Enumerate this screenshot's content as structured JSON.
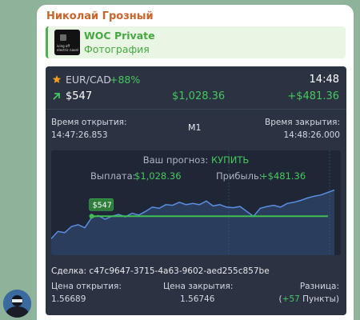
{
  "message": {
    "sender": "Николай Грозный",
    "reply": {
      "title": "WOC Private",
      "subtitle": "Фотография",
      "thumb_text": "iving off\nelectric navel"
    }
  },
  "trade": {
    "pair": "EUR/CAD",
    "pair_change": "+88%",
    "time": "14:48",
    "stake": "$547",
    "payout": "$1,028.36",
    "profit": "+$481.36",
    "open_label": "Время открытия:",
    "open_time": "14:47:26.853",
    "timeframe": "M1",
    "close_label": "Время закрытия:",
    "close_time": "14:48:26.000",
    "forecast_label": "Ваш прогноз:",
    "forecast_value": "КУПИТЬ",
    "payout_label": "Выплата:",
    "payout_value": "$1,028.36",
    "profit_label": "Прибыль:",
    "profit_value": "+$481.36",
    "entry_marker": "$547",
    "deal_label": "Сделка:",
    "deal_id": "c47c9647-3715-4a63-9602-aed255c857be",
    "open_price_label": "Цена открытия:",
    "open_price": "1.56689",
    "close_price_label": "Цена закрытия:",
    "close_price": "1.56746",
    "diff_label": "Разница:",
    "diff_open": "(",
    "diff_value": "+57",
    "diff_suffix": " Пункты)"
  },
  "colors": {
    "green": "#47c85f",
    "orange_star": "#f39c1f",
    "card_bg": "#2b3242",
    "chart_line": "#4f7fcf"
  },
  "icons": {
    "star": "star-icon",
    "trend": "arrow-up-right-icon"
  },
  "chart_data": {
    "type": "area",
    "series": [
      {
        "values": [
          0.1,
          0.22,
          0.2,
          0.3,
          0.33,
          0.28,
          0.45,
          0.48,
          0.42,
          0.47,
          0.5,
          0.46,
          0.52,
          0.49,
          0.55,
          0.62,
          0.6,
          0.66,
          0.65,
          0.7,
          0.66,
          0.68,
          0.66,
          0.72,
          0.64,
          0.66,
          0.62,
          0.61,
          0.63,
          0.55,
          0.47,
          0.6,
          0.63,
          0.65,
          0.62,
          0.68,
          0.7,
          0.73,
          0.77,
          0.8,
          0.82,
          0.86,
          0.9
        ]
      }
    ],
    "entry_level": 0.47,
    "entry_index": 6
  }
}
